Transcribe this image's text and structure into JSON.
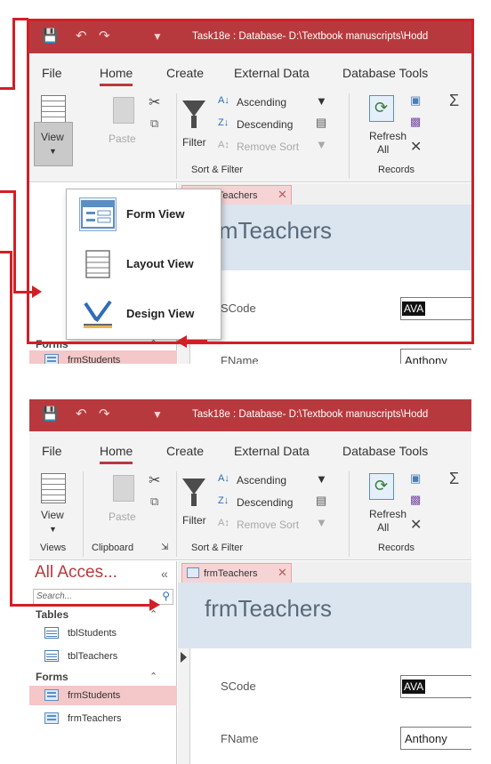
{
  "title_bar": {
    "title": "Task18e : Database- D:\\Textbook manuscripts\\Hodd",
    "save_icon": "save-icon",
    "undo_icon": "undo-icon",
    "redo_icon": "redo-icon",
    "customize_icon": "customize-quick-access-icon"
  },
  "ribbon_tabs": [
    "File",
    "Home",
    "Create",
    "External Data",
    "Database Tools"
  ],
  "ribbon": {
    "view_label": "View",
    "paste_label": "Paste",
    "filter_label": "Filter",
    "ascending_label": "Ascending",
    "descending_label": "Descending",
    "remove_sort_label": "Remove Sort",
    "refresh_label": "Refresh",
    "refresh_all_label": "All",
    "groups": {
      "views": "Views",
      "clipboard": "Clipboard",
      "sort_filter": "Sort & Filter",
      "records": "Records"
    }
  },
  "view_menu": {
    "items": [
      {
        "label": "Form View",
        "icon": "form-view-icon"
      },
      {
        "label": "Layout View",
        "icon": "layout-view-icon"
      },
      {
        "label": "Design View",
        "icon": "design-view-icon"
      }
    ]
  },
  "nav_pane": {
    "header": "All Acces...",
    "search_placeholder": "Search...",
    "groups": [
      {
        "name": "Tables",
        "items": [
          "tblStudents",
          "tblTeachers"
        ]
      },
      {
        "name": "Forms",
        "items": [
          "frmStudents",
          "frmTeachers"
        ]
      }
    ],
    "selected_item": "frmStudents"
  },
  "document": {
    "tab_label": "frmTeachers",
    "form_title": "frmTeachers",
    "fields": [
      {
        "label": "SCode",
        "value": "AVA"
      },
      {
        "label": "FName",
        "value": "Anthony"
      }
    ]
  },
  "colors": {
    "accent": "#b8393d",
    "callout": "#d21f26",
    "form_header": "#dbe5f0",
    "selected_item": "#f4c7c8"
  }
}
